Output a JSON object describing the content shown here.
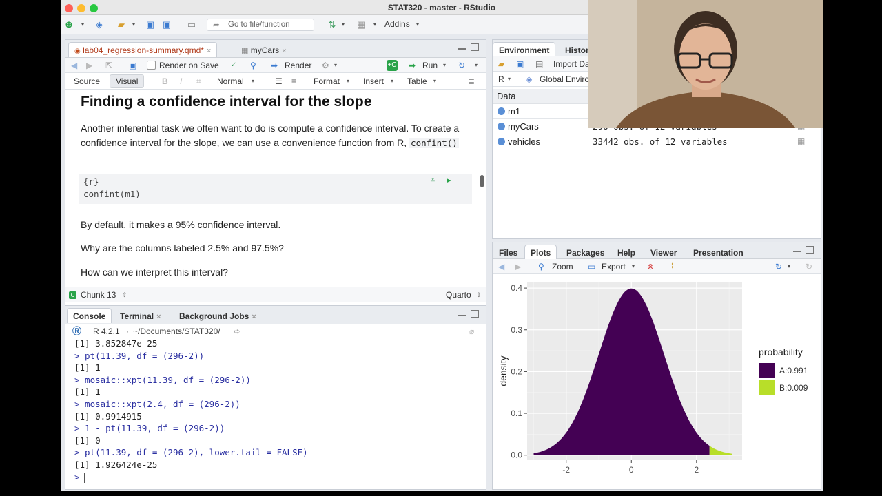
{
  "window": {
    "title": "STAT320 - master - RStudio"
  },
  "toolbar": {
    "goto_placeholder": "Go to file/function",
    "addins": "Addins"
  },
  "editor": {
    "tabs": [
      {
        "label": "lab04_regression-summary.qmd*"
      },
      {
        "label": "myCars"
      }
    ],
    "render_on_save": "Render on Save",
    "render": "Render",
    "run": "Run",
    "mode_source": "Source",
    "mode_visual": "Visual",
    "format_normal": "Normal",
    "menu_format": "Format",
    "menu_insert": "Insert",
    "menu_table": "Table",
    "bold": "B",
    "italic": "I",
    "heading": "Finding a confidence interval for the slope",
    "para1_text": "Another inferential task we often want to do is compute a confidence interval. To create a confidence interval for the slope, we can use a convenience function from R,",
    "para1_code": "confint()",
    "chunk_header": "{r}",
    "chunk_code": "confint(m1)",
    "para2": "By default, it makes a 95% confidence interval.",
    "para3": "Why are the columns labeled 2.5% and 97.5%?",
    "para4": "How can we interpret this interval?",
    "status_chunk": "Chunk 13",
    "status_type": "Quarto"
  },
  "console": {
    "tabs": [
      {
        "label": "Console"
      },
      {
        "label": "Terminal"
      },
      {
        "label": "Background Jobs"
      }
    ],
    "r_version": "R 4.2.1",
    "path": "~/Documents/STAT320/",
    "lines": [
      {
        "kind": "out",
        "text": "[1] 3.852847e-25"
      },
      {
        "kind": "in",
        "text": "> pt(11.39, df = (296-2))"
      },
      {
        "kind": "out",
        "text": "[1] 1"
      },
      {
        "kind": "in",
        "text": "> mosaic::xpt(11.39, df = (296-2))"
      },
      {
        "kind": "out",
        "text": "[1] 1"
      },
      {
        "kind": "in",
        "text": "> mosaic::xpt(2.4, df = (296-2))"
      },
      {
        "kind": "out",
        "text": "[1] 0.9914915"
      },
      {
        "kind": "in",
        "text": "> 1 - pt(11.39, df = (296-2))"
      },
      {
        "kind": "out",
        "text": "[1] 0"
      },
      {
        "kind": "in",
        "text": "> pt(11.39, df = (296-2), lower.tail = FALSE)"
      },
      {
        "kind": "out",
        "text": "[1] 1.926424e-25"
      },
      {
        "kind": "in",
        "text": ">"
      }
    ]
  },
  "environment": {
    "tabs": [
      {
        "label": "Environment"
      },
      {
        "label": "Histor"
      }
    ],
    "import": "Import Da",
    "lang": "R",
    "scope": "Global Enviro",
    "section": "Data",
    "rows": [
      {
        "name": "m1",
        "desc": ""
      },
      {
        "name": "myCars",
        "desc": "296 obs. of 12 variables"
      },
      {
        "name": "vehicles",
        "desc": "33442 obs. of 12 variables"
      }
    ]
  },
  "plots": {
    "tabs": [
      {
        "label": "Files"
      },
      {
        "label": "Plots"
      },
      {
        "label": "Packages"
      },
      {
        "label": "Help"
      },
      {
        "label": "Viewer"
      },
      {
        "label": "Presentation"
      }
    ],
    "zoom": "Zoom",
    "export": "Export"
  },
  "chart_data": {
    "type": "area",
    "ylabel": "density",
    "xlabel": "",
    "x_ticks": [
      "-2",
      "0",
      "2"
    ],
    "y_ticks": [
      "0.0",
      "0.1",
      "0.2",
      "0.3",
      "0.4"
    ],
    "xlim": [
      -3.2,
      3.4
    ],
    "ylim": [
      -0.012,
      0.415
    ],
    "cutoff": 2.4,
    "legend_title": "probability",
    "legend_position": "right",
    "series": [
      {
        "name": "A:0.991",
        "color": "#440154",
        "x_range": [
          -3,
          2.4
        ]
      },
      {
        "name": "B:0.009",
        "color": "#b8de29",
        "x_range": [
          2.4,
          3.1
        ]
      }
    ],
    "grid": true
  }
}
